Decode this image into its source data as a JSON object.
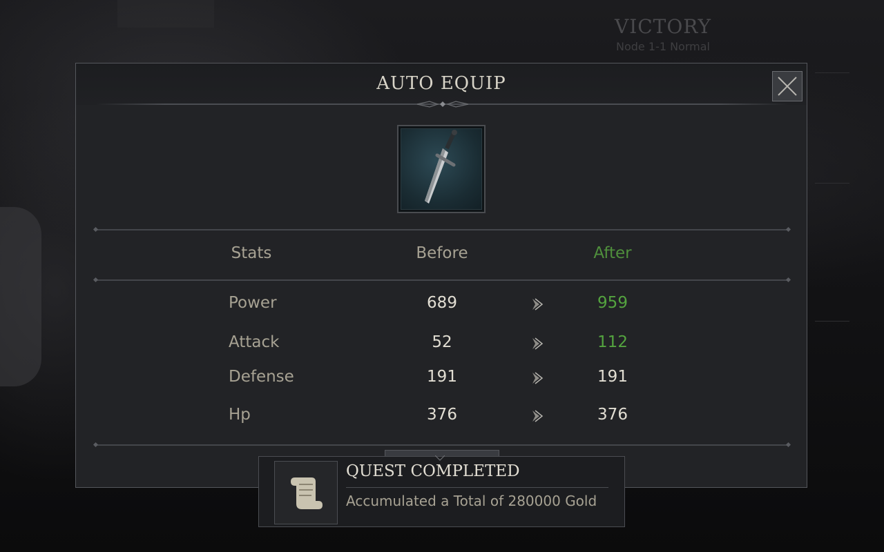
{
  "background": {
    "victory_title": "VICTORY",
    "victory_subtitle": "Node 1-1 Normal"
  },
  "modal": {
    "title": "AUTO EQUIP",
    "item_icon": "sword-icon",
    "columns": {
      "stats": "Stats",
      "before": "Before",
      "after": "After"
    },
    "rows": [
      {
        "label": "Power",
        "before": "689",
        "after": "959",
        "increased": true
      },
      {
        "label": "Attack",
        "before": "52",
        "after": "112",
        "increased": true
      },
      {
        "label": "Defense",
        "before": "191",
        "after": "191",
        "increased": false
      },
      {
        "label": "Hp",
        "before": "376",
        "after": "376",
        "increased": false
      }
    ]
  },
  "toast": {
    "title": "QUEST COMPLETED",
    "description": "Accumulated a Total of 280000 Gold",
    "icon": "scroll-icon"
  },
  "colors": {
    "increase_green": "#54a43f",
    "after_header_green": "#4f8f3c",
    "label_tan": "#a7a293",
    "value_white": "#e2ded3"
  }
}
